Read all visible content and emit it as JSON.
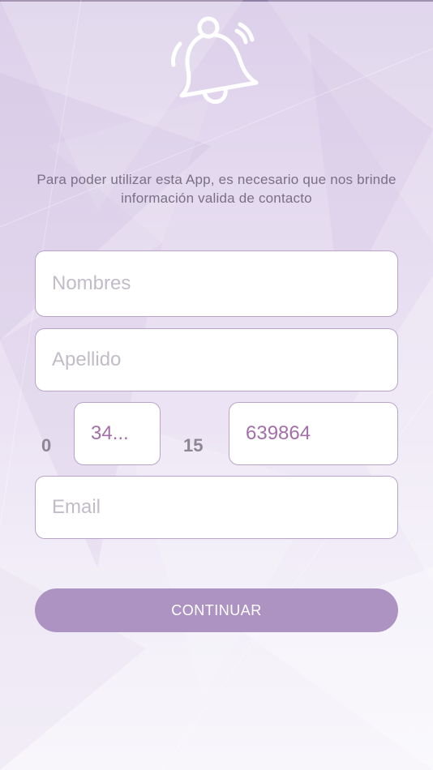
{
  "colors": {
    "accent": "#ad93c2",
    "field_border": "#b9a4c8",
    "value_text": "#a46fa9",
    "placeholder_text": "#c2bcc8",
    "intro_text": "#7a7086",
    "prefix_text": "#8d8694"
  },
  "header": {
    "icon": "bell-ringing-icon"
  },
  "intro": {
    "text": "Para poder utilizar esta App, es necesario que nos brinde información valida de contacto"
  },
  "form": {
    "nombres": {
      "placeholder": "Nombres",
      "value": ""
    },
    "apellido": {
      "placeholder": "Apellido",
      "value": ""
    },
    "phone": {
      "prefix_zero": "0",
      "area_code_value": "34...",
      "prefix_fifteen": "15",
      "number_value": "639864"
    },
    "email": {
      "placeholder": "Email",
      "value": ""
    }
  },
  "actions": {
    "continue_label": "CONTINUAR"
  }
}
